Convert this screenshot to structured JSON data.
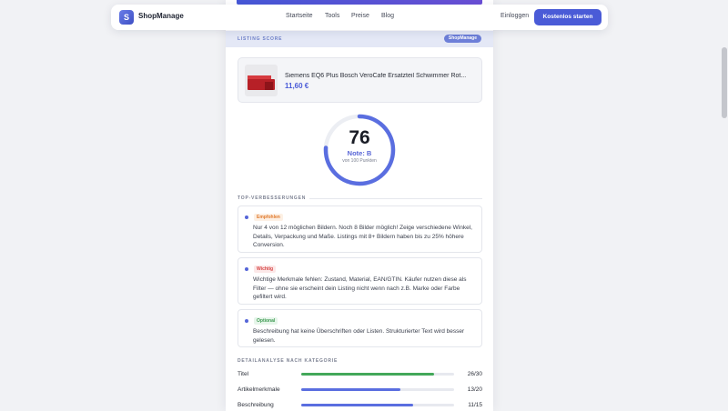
{
  "nav": {
    "brand": "ShopManage",
    "logo_letter": "S",
    "links": [
      "Startseite",
      "Tools",
      "Preise",
      "Blog"
    ],
    "login": "Einloggen",
    "cta": "Kostenlos starten"
  },
  "score_panel": {
    "header_label": "LISTING SCORE",
    "brand_badge": "ShopManage"
  },
  "product": {
    "title": "Siemens EQ6 Plus Bosch VeroCafe Ersatzteil Schwimmer Rot...",
    "price": "11,60 €"
  },
  "score": {
    "value": "76",
    "max": 100,
    "grade": "Note: B",
    "subtitle": "von 100 Punkten",
    "ring_color": "#5a6ee0",
    "track_color": "#eceef3"
  },
  "improvements": {
    "title": "TOP-VERBESSERUNGEN",
    "items": [
      {
        "badge": "Empfohlen",
        "badge_color": "#e0792c",
        "badge_bg": "#fdf0e4",
        "text": "Nur 4 von 12 möglichen Bildern. Noch 8 Bilder möglich! Zeige verschiedene Winkel, Details, Verpackung und Maße. Listings mit 8+ Bildern haben bis zu 25% höhere Conversion."
      },
      {
        "badge": "Wichtig",
        "badge_color": "#d64545",
        "badge_bg": "#fce8e8",
        "text": "Wichtige Merkmale fehlen: Zustand, Material, EAN/GTIN. Käufer nutzen diese als Filter — ohne sie erscheint dein Listing nicht wenn nach z.B. Marke oder Farbe gefiltert wird."
      },
      {
        "badge": "Optional",
        "badge_color": "#3f9a52",
        "badge_bg": "#e6f5ea",
        "text": "Beschreibung hat keine Überschriften oder Listen. Strukturierter Text wird besser gelesen."
      }
    ]
  },
  "details": {
    "title": "DETAILANALYSE NACH KATEGORIE",
    "rows": [
      {
        "label": "Titel",
        "value": "26/30",
        "score": 26,
        "max": 30,
        "color": "#43a85a"
      },
      {
        "label": "Artikelmerkmale",
        "value": "13/20",
        "score": 13,
        "max": 20,
        "color": "#5a6ee0"
      },
      {
        "label": "Beschreibung",
        "value": "11/15",
        "score": 11,
        "max": 15,
        "color": "#5a6ee0"
      }
    ]
  }
}
